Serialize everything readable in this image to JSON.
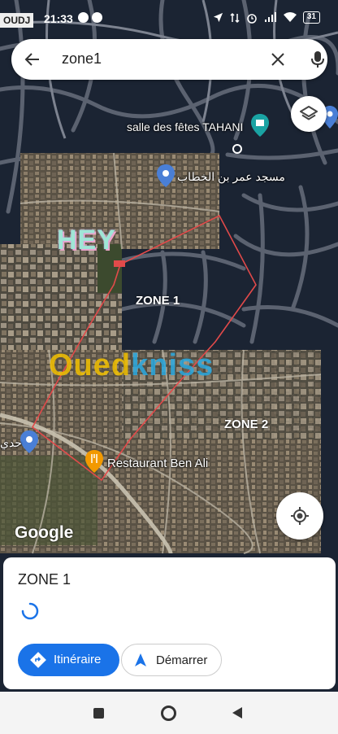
{
  "status_bar": {
    "carrier": "OUDJ",
    "time": "21:33",
    "battery": "31"
  },
  "search": {
    "query": "zone1",
    "back_icon": "arrow-left-icon",
    "clear_icon": "close-icon",
    "mic_icon": "microphone-icon"
  },
  "map": {
    "places": {
      "venue": "salle des fêtes TAHANI",
      "mosque": "مسجد عمر بن الخطاب",
      "restaurant": "Restaurant Ben Ali",
      "left_edge": "حدي"
    },
    "zone1_label": "ZONE 1",
    "zone2_label": "ZONE 2",
    "sticker": "HEY",
    "watermark_part1": "Oued",
    "watermark_part2": "kniss",
    "google_logo": "Google",
    "colors": {
      "zone_outline": "#e24a4a",
      "pin_blue": "#4a7fd6",
      "pin_orange": "#f29900"
    }
  },
  "card": {
    "title": "ZONE 1",
    "directions_label": "Itinéraire",
    "start_label": "Démarrer"
  },
  "colors": {
    "primary": "#1a73e8"
  }
}
